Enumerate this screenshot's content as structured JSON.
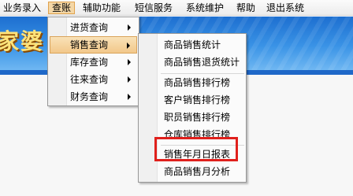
{
  "menubar": {
    "items": [
      "业务录入",
      "查账",
      "辅助功能",
      "短信服务",
      "系统维护",
      "帮助",
      "退出系统"
    ]
  },
  "banner": {
    "logo_text": "家婆"
  },
  "query_menu": {
    "items": [
      "进货查询",
      "销售查询",
      "库存查询",
      "往来查询",
      "财务查询"
    ]
  },
  "sales_menu": {
    "items": [
      "商品销售统计",
      "商品销售退货统计",
      "商品销售排行榜",
      "客户销售排行榜",
      "职员销售排行榜",
      "仓库销售排行榜",
      "销售年月日报表",
      "商品销售月分析"
    ]
  },
  "colors": {
    "highlight_border": "#e0201c",
    "menu_hover": "#f2c88a",
    "banner_blue": "#1d6fd0"
  }
}
